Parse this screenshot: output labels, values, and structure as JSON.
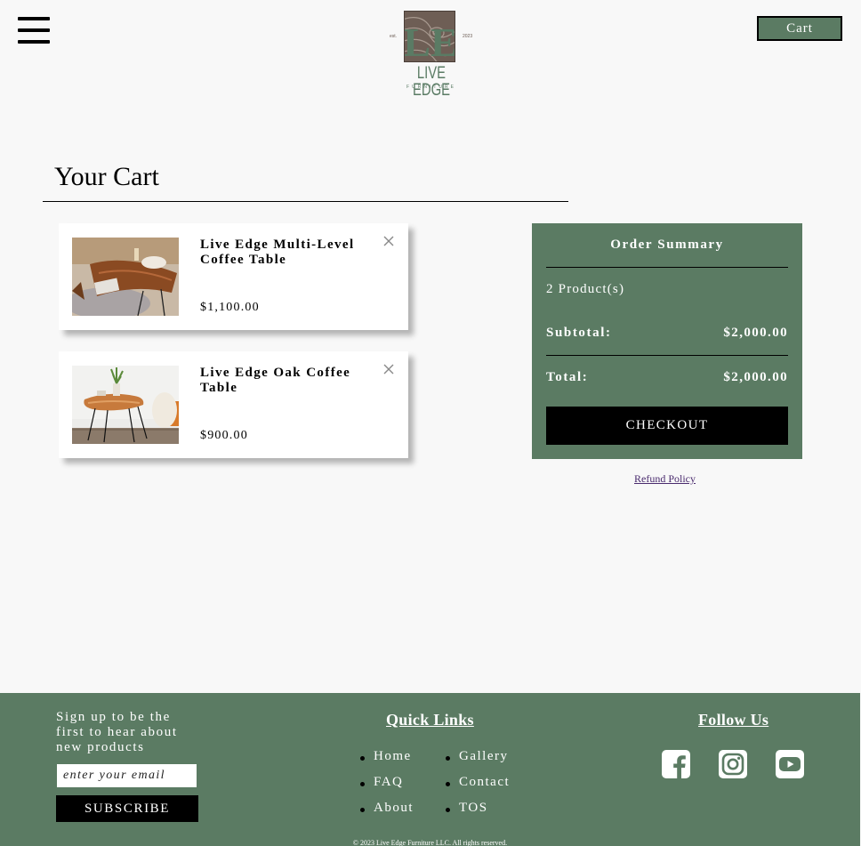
{
  "header": {
    "logo": {
      "text": "LIVE EDGE",
      "sub": "FURNITURE",
      "est_left": "est.",
      "est_right": "2023",
      "monogram": "LE"
    },
    "cart_label": "Cart"
  },
  "cart": {
    "title": "Your Cart",
    "items": [
      {
        "name": "Live Edge Multi-Level Coffee Table",
        "price": "$1,100.00",
        "image_icon": "coffee-table-photo"
      },
      {
        "name": "Live Edge Oak Coffee Table",
        "price": "$900.00",
        "image_icon": "oak-table-photo"
      }
    ]
  },
  "summary": {
    "title": "Order Summary",
    "count": "2 Product(s)",
    "subtotal_label": "Subtotal:",
    "subtotal_value": "$2,000.00",
    "total_label": "Total:",
    "total_value": "$2,000.00",
    "checkout_label": "CHECKOUT",
    "refund_label": "Refund Policy"
  },
  "footer": {
    "signup_text": "Sign up to be the first to hear about new products",
    "email_placeholder": "enter your email",
    "subscribe_label": "SUBSCRIBE",
    "quick_links_title": "Quick Links",
    "links_col1": [
      "Home",
      "FAQ",
      "About"
    ],
    "links_col2": [
      "Gallery",
      "Contact",
      "TOS"
    ],
    "follow_title": "Follow Us",
    "social": [
      "facebook-icon",
      "instagram-icon",
      "youtube-icon"
    ],
    "copyright": "© 2023 Live Edge Furniture LLC. All rights reserved."
  },
  "colors": {
    "brand_green": "#5b7b63",
    "background": "#f8f8f8",
    "button_black": "#000000"
  }
}
